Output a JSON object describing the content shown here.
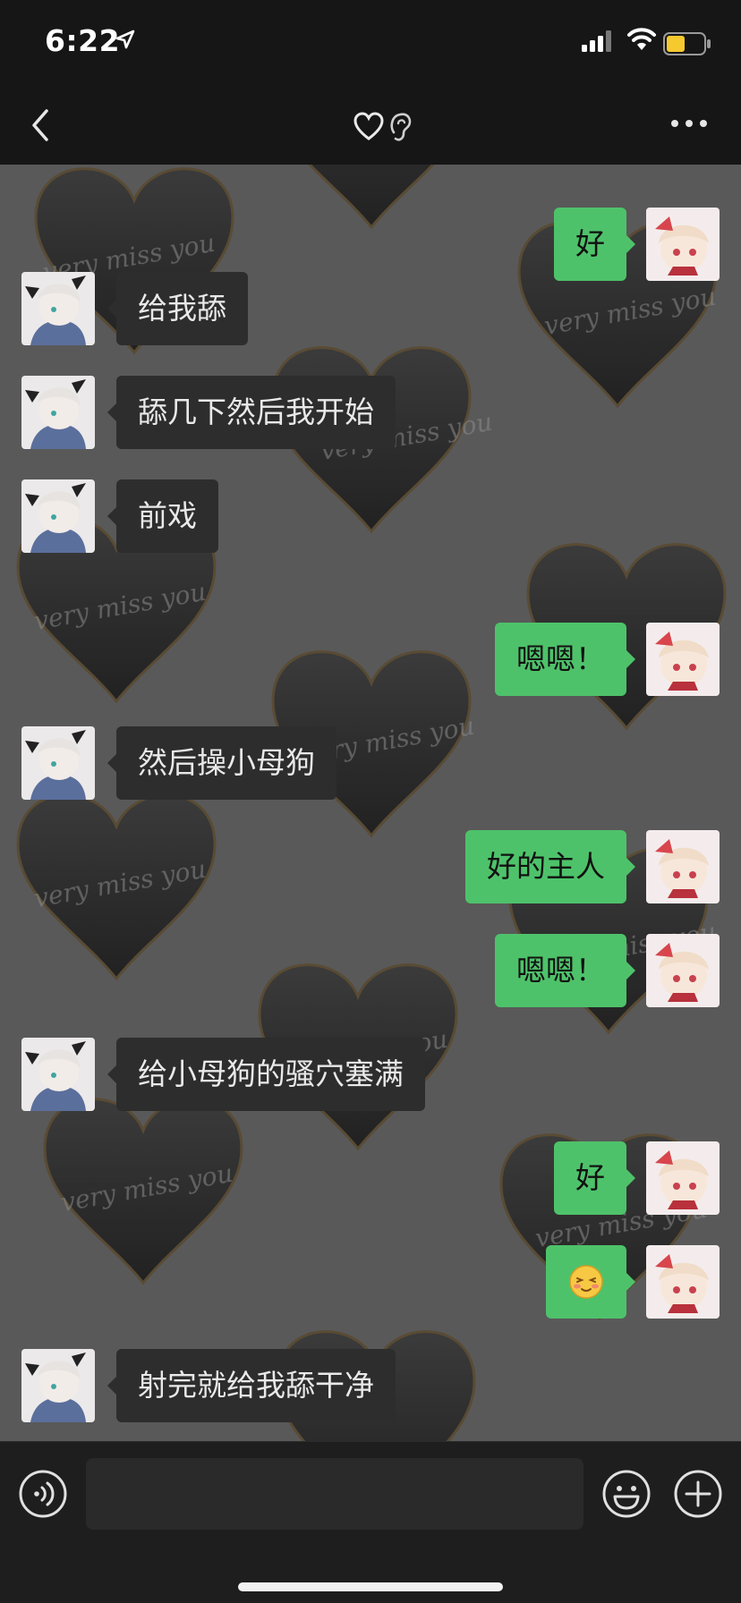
{
  "status_bar": {
    "time": "6:22"
  },
  "nav": {
    "title_icons": [
      "heart-icon",
      "ear-icon"
    ]
  },
  "wallpaper": {
    "caption": "very miss you"
  },
  "messages": [
    {
      "side": "right",
      "text": "好"
    },
    {
      "side": "left",
      "text": "给我舔"
    },
    {
      "side": "left",
      "text": "舔几下然后我开始"
    },
    {
      "side": "left",
      "text": "前戏"
    },
    {
      "side": "right",
      "text": "嗯嗯！"
    },
    {
      "side": "left",
      "text": "然后操小母狗"
    },
    {
      "side": "right",
      "text": "好的主人"
    },
    {
      "side": "right",
      "text": "嗯嗯！"
    },
    {
      "side": "left",
      "text": "给小母狗的骚穴塞满"
    },
    {
      "side": "right",
      "text": "好"
    },
    {
      "side": "right",
      "text": "😳",
      "icon": "blushing-emoji"
    },
    {
      "side": "left",
      "text": "射完就给我舔干净"
    }
  ],
  "input": {
    "placeholder": "",
    "value": ""
  },
  "colors": {
    "bubble_sent": "#4ec26a",
    "bubble_received": "#2d2d2d",
    "chat_background": "#595959",
    "bar_background": "#161616"
  }
}
